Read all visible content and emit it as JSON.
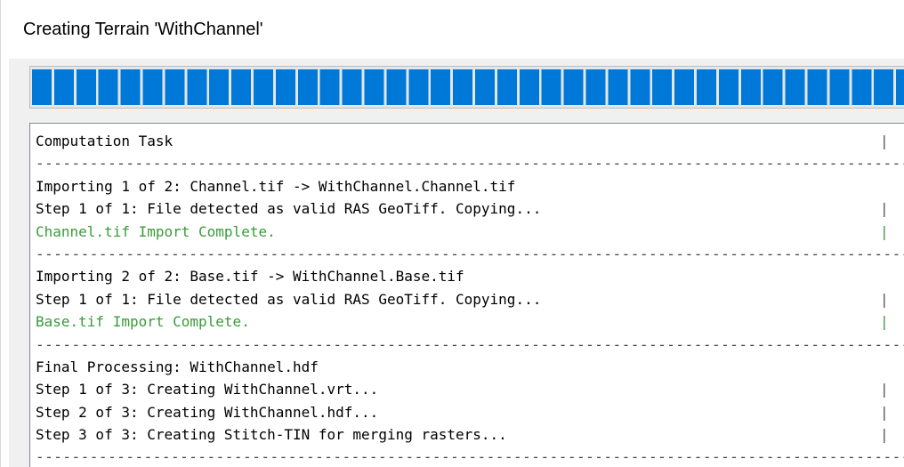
{
  "window": {
    "title": "Creating Terrain 'WithChannel'"
  },
  "progress": {
    "fraction": 1.0
  },
  "log": {
    "lines": [
      {
        "kind": "normal",
        "text": "Computation Task",
        "bar": "|"
      },
      {
        "kind": "separator",
        "text": "----------------------------------------------------------------------------------------------------------------------------------------------------------------------------------------"
      },
      {
        "kind": "normal",
        "text": "Importing 1 of 2: Channel.tif -> WithChannel.Channel.tif",
        "bar": ""
      },
      {
        "kind": "normal",
        "text": "Step 1 of 1: File detected as valid RAS GeoTiff. Copying...",
        "bar": "|"
      },
      {
        "kind": "success",
        "text": "Channel.tif Import Complete.",
        "bar": "|"
      },
      {
        "kind": "separator",
        "text": "----------------------------------------------------------------------------------------------------------------------------------------------------------------------------------------"
      },
      {
        "kind": "normal",
        "text": "Importing 2 of 2: Base.tif -> WithChannel.Base.tif",
        "bar": ""
      },
      {
        "kind": "normal",
        "text": "Step 1 of 1: File detected as valid RAS GeoTiff. Copying...",
        "bar": "|"
      },
      {
        "kind": "success",
        "text": "Base.tif Import Complete.",
        "bar": "|"
      },
      {
        "kind": "separator",
        "text": "----------------------------------------------------------------------------------------------------------------------------------------------------------------------------------------"
      },
      {
        "kind": "normal",
        "text": "Final Processing: WithChannel.hdf",
        "bar": ""
      },
      {
        "kind": "normal",
        "text": "Step 1 of 3: Creating WithChannel.vrt...",
        "bar": "|"
      },
      {
        "kind": "normal",
        "text": "Step 2 of 3: Creating WithChannel.hdf...",
        "bar": "|"
      },
      {
        "kind": "normal",
        "text": "Step 3 of 3: Creating Stitch-TIN for merging rasters...",
        "bar": "|"
      },
      {
        "kind": "separator",
        "text": "----------------------------------------------------------------------------------------------------------------------------------------------------------------------------------------"
      }
    ]
  }
}
